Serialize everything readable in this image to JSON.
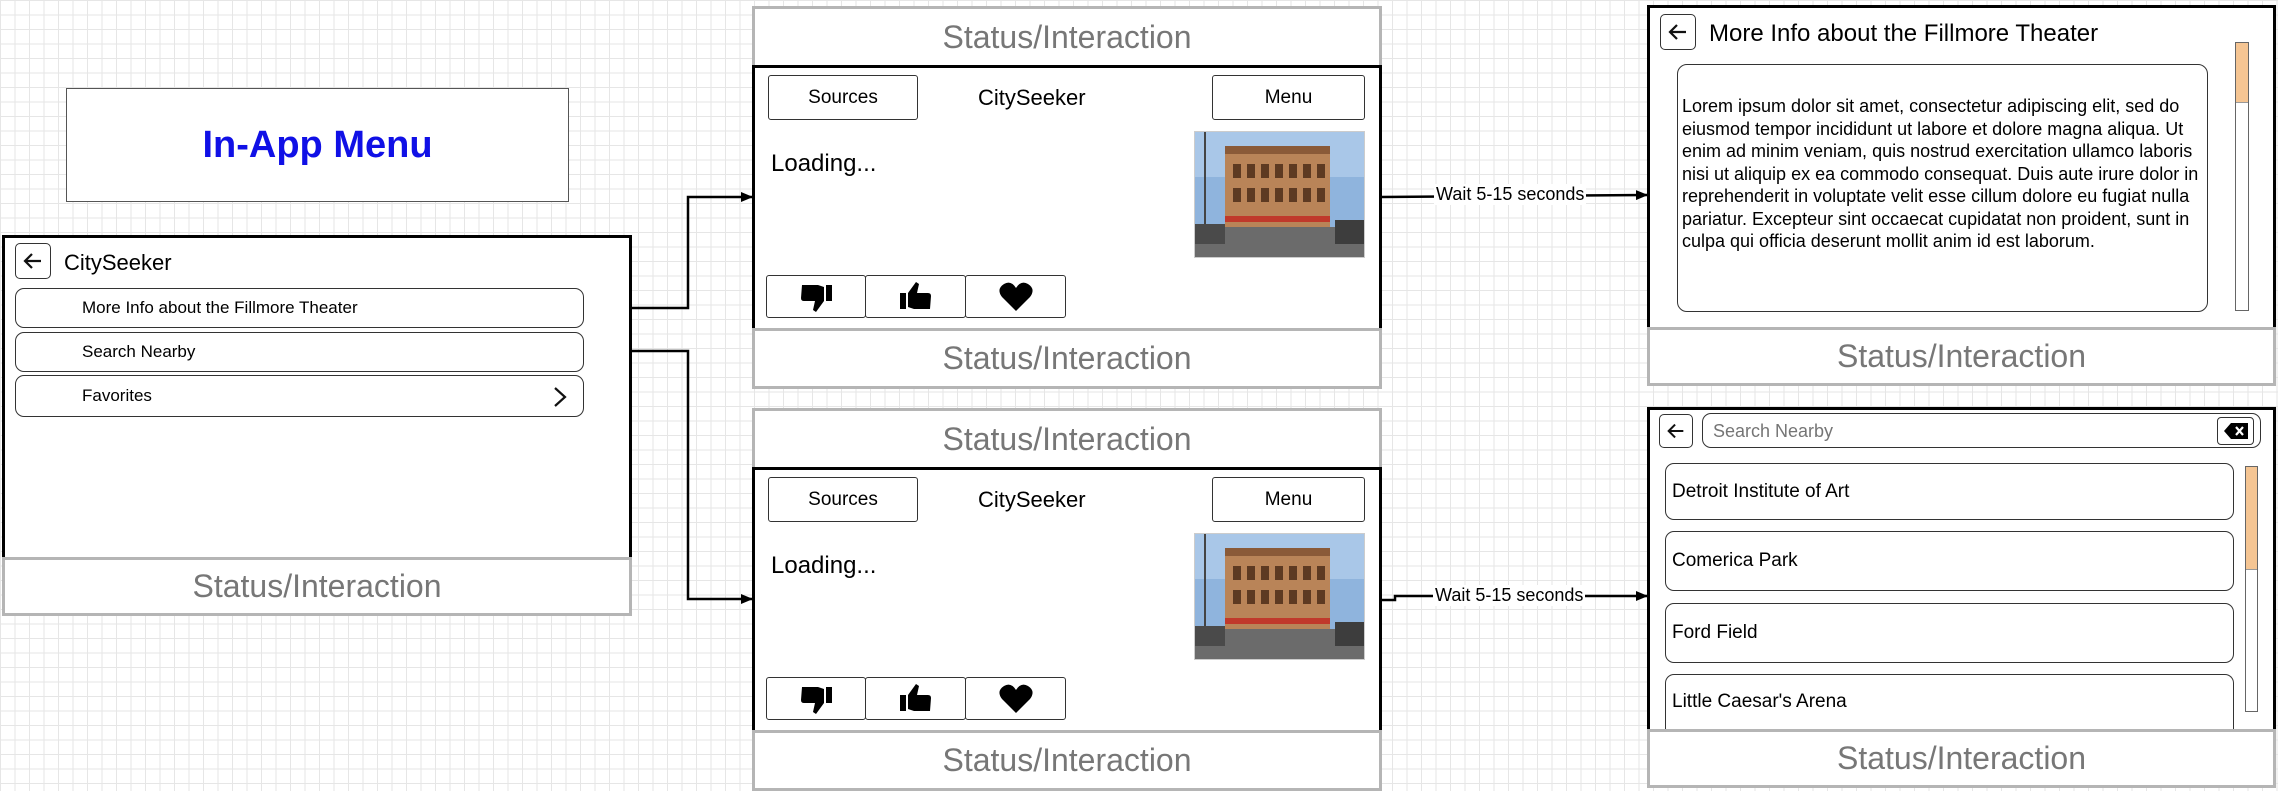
{
  "diagram_title": "In-App Menu",
  "status_label": "Status/Interaction",
  "app_name": "CitySeeker",
  "menu_screen": {
    "items": [
      {
        "label": "More Info about the Fillmore Theater"
      },
      {
        "label": "Search Nearby"
      },
      {
        "label": "Favorites"
      }
    ]
  },
  "content_screen": {
    "sources_label": "Sources",
    "menu_label": "Menu",
    "loading_text": "Loading..."
  },
  "transition_label": "Wait 5-15 seconds",
  "info_screen": {
    "title": "More Info about the Fillmore Theater",
    "body": "Lorem ipsum dolor sit amet, consectetur adipiscing elit, sed do eiusmod tempor incididunt ut labore et dolore magna aliqua. Ut enim ad minim veniam, quis nostrud exercitation ullamco laboris nisi ut aliquip ex ea commodo consequat. Duis aute irure dolor in reprehenderit in voluptate velit esse cillum dolore eu fugiat nulla pariatur. Excepteur sint occaecat cupidatat non proident, sunt in culpa qui officia deserunt mollit anim id est laborum.",
    "scroll_fraction": 0.22
  },
  "search_screen": {
    "placeholder": "Search Nearby",
    "results": [
      {
        "label": "Detroit Institute of Art"
      },
      {
        "label": "Comerica Park"
      },
      {
        "label": "Ford Field"
      },
      {
        "label": "Little Caesar's Arena"
      }
    ],
    "scroll_fraction": 0.42
  },
  "icons": {
    "back": "back-arrow-icon",
    "chevron": "chevron-right-icon",
    "dislike": "thumbs-down-icon",
    "like": "thumbs-up-icon",
    "favorite": "heart-icon",
    "clear": "clear-input-icon"
  }
}
